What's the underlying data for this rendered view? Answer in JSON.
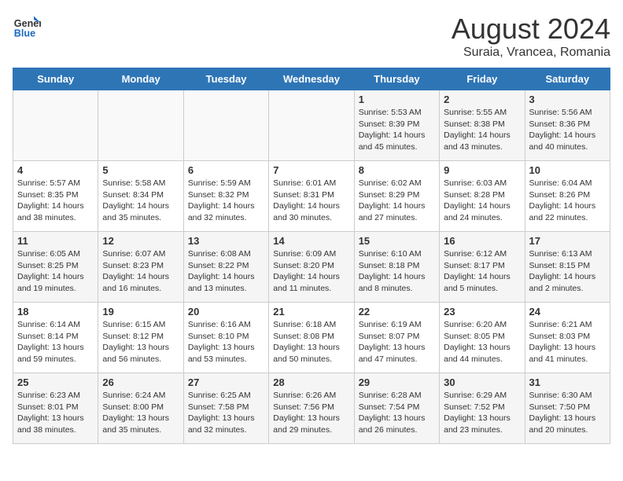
{
  "header": {
    "logo_line1": "General",
    "logo_line2": "Blue",
    "month_year": "August 2024",
    "location": "Suraia, Vrancea, Romania"
  },
  "days_of_week": [
    "Sunday",
    "Monday",
    "Tuesday",
    "Wednesday",
    "Thursday",
    "Friday",
    "Saturday"
  ],
  "weeks": [
    [
      {
        "day": "",
        "info": ""
      },
      {
        "day": "",
        "info": ""
      },
      {
        "day": "",
        "info": ""
      },
      {
        "day": "",
        "info": ""
      },
      {
        "day": "1",
        "info": "Sunrise: 5:53 AM\nSunset: 8:39 PM\nDaylight: 14 hours\nand 45 minutes."
      },
      {
        "day": "2",
        "info": "Sunrise: 5:55 AM\nSunset: 8:38 PM\nDaylight: 14 hours\nand 43 minutes."
      },
      {
        "day": "3",
        "info": "Sunrise: 5:56 AM\nSunset: 8:36 PM\nDaylight: 14 hours\nand 40 minutes."
      }
    ],
    [
      {
        "day": "4",
        "info": "Sunrise: 5:57 AM\nSunset: 8:35 PM\nDaylight: 14 hours\nand 38 minutes."
      },
      {
        "day": "5",
        "info": "Sunrise: 5:58 AM\nSunset: 8:34 PM\nDaylight: 14 hours\nand 35 minutes."
      },
      {
        "day": "6",
        "info": "Sunrise: 5:59 AM\nSunset: 8:32 PM\nDaylight: 14 hours\nand 32 minutes."
      },
      {
        "day": "7",
        "info": "Sunrise: 6:01 AM\nSunset: 8:31 PM\nDaylight: 14 hours\nand 30 minutes."
      },
      {
        "day": "8",
        "info": "Sunrise: 6:02 AM\nSunset: 8:29 PM\nDaylight: 14 hours\nand 27 minutes."
      },
      {
        "day": "9",
        "info": "Sunrise: 6:03 AM\nSunset: 8:28 PM\nDaylight: 14 hours\nand 24 minutes."
      },
      {
        "day": "10",
        "info": "Sunrise: 6:04 AM\nSunset: 8:26 PM\nDaylight: 14 hours\nand 22 minutes."
      }
    ],
    [
      {
        "day": "11",
        "info": "Sunrise: 6:05 AM\nSunset: 8:25 PM\nDaylight: 14 hours\nand 19 minutes."
      },
      {
        "day": "12",
        "info": "Sunrise: 6:07 AM\nSunset: 8:23 PM\nDaylight: 14 hours\nand 16 minutes."
      },
      {
        "day": "13",
        "info": "Sunrise: 6:08 AM\nSunset: 8:22 PM\nDaylight: 14 hours\nand 13 minutes."
      },
      {
        "day": "14",
        "info": "Sunrise: 6:09 AM\nSunset: 8:20 PM\nDaylight: 14 hours\nand 11 minutes."
      },
      {
        "day": "15",
        "info": "Sunrise: 6:10 AM\nSunset: 8:18 PM\nDaylight: 14 hours\nand 8 minutes."
      },
      {
        "day": "16",
        "info": "Sunrise: 6:12 AM\nSunset: 8:17 PM\nDaylight: 14 hours\nand 5 minutes."
      },
      {
        "day": "17",
        "info": "Sunrise: 6:13 AM\nSunset: 8:15 PM\nDaylight: 14 hours\nand 2 minutes."
      }
    ],
    [
      {
        "day": "18",
        "info": "Sunrise: 6:14 AM\nSunset: 8:14 PM\nDaylight: 13 hours\nand 59 minutes."
      },
      {
        "day": "19",
        "info": "Sunrise: 6:15 AM\nSunset: 8:12 PM\nDaylight: 13 hours\nand 56 minutes."
      },
      {
        "day": "20",
        "info": "Sunrise: 6:16 AM\nSunset: 8:10 PM\nDaylight: 13 hours\nand 53 minutes."
      },
      {
        "day": "21",
        "info": "Sunrise: 6:18 AM\nSunset: 8:08 PM\nDaylight: 13 hours\nand 50 minutes."
      },
      {
        "day": "22",
        "info": "Sunrise: 6:19 AM\nSunset: 8:07 PM\nDaylight: 13 hours\nand 47 minutes."
      },
      {
        "day": "23",
        "info": "Sunrise: 6:20 AM\nSunset: 8:05 PM\nDaylight: 13 hours\nand 44 minutes."
      },
      {
        "day": "24",
        "info": "Sunrise: 6:21 AM\nSunset: 8:03 PM\nDaylight: 13 hours\nand 41 minutes."
      }
    ],
    [
      {
        "day": "25",
        "info": "Sunrise: 6:23 AM\nSunset: 8:01 PM\nDaylight: 13 hours\nand 38 minutes."
      },
      {
        "day": "26",
        "info": "Sunrise: 6:24 AM\nSunset: 8:00 PM\nDaylight: 13 hours\nand 35 minutes."
      },
      {
        "day": "27",
        "info": "Sunrise: 6:25 AM\nSunset: 7:58 PM\nDaylight: 13 hours\nand 32 minutes."
      },
      {
        "day": "28",
        "info": "Sunrise: 6:26 AM\nSunset: 7:56 PM\nDaylight: 13 hours\nand 29 minutes."
      },
      {
        "day": "29",
        "info": "Sunrise: 6:28 AM\nSunset: 7:54 PM\nDaylight: 13 hours\nand 26 minutes."
      },
      {
        "day": "30",
        "info": "Sunrise: 6:29 AM\nSunset: 7:52 PM\nDaylight: 13 hours\nand 23 minutes."
      },
      {
        "day": "31",
        "info": "Sunrise: 6:30 AM\nSunset: 7:50 PM\nDaylight: 13 hours\nand 20 minutes."
      }
    ]
  ]
}
